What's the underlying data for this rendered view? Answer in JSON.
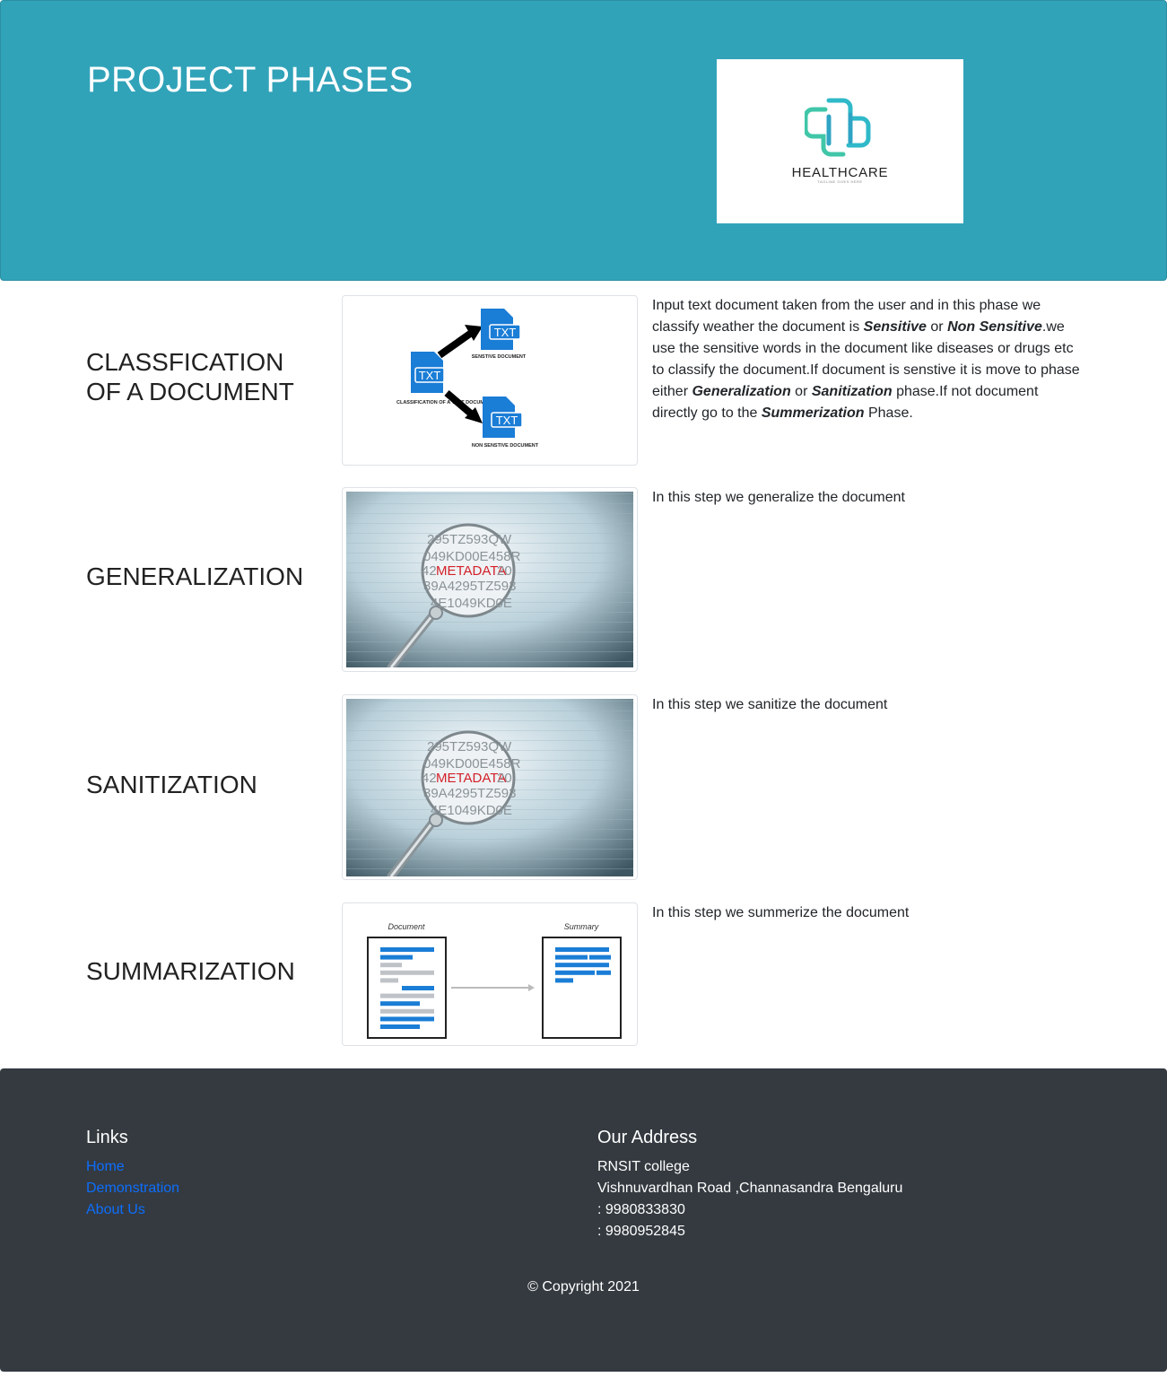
{
  "header": {
    "title": "PROJECT PHASES",
    "logo": {
      "name": "HEALTHCARE",
      "tagline": "TAGLINE GOES HERE"
    }
  },
  "phases": [
    {
      "title_line1": "CLASSFICATION",
      "title_line2": "OF A DOCUMENT",
      "diagram": {
        "source_label": "CLASSIFICATION OF A TEXT DOCUMENT",
        "file_label": "TXT",
        "sensitive_label": "SENSTIVE DOCUMENT",
        "nonsensitive_label": "NON SENSTIVE DOCUMENT"
      },
      "desc": {
        "p1": "Input text document taken from the user and in this phase we classify weather the document is ",
        "sensitive": "Sensitive",
        "or1": " or ",
        "non_sensitive": "Non Sensitive",
        "p2": ".we use the sensitive words in the document like diseases or drugs etc to classify the document.If document is senstive it is move to phase either ",
        "generalization": "Generalization",
        "or2": " or ",
        "sanitization": "Sanitization",
        "p3": " phase.If not document directly go to the ",
        "summerization": "Summerization",
        "p4": " Phase."
      }
    },
    {
      "title": "GENERALIZATION",
      "image": {
        "lines": [
          "295TZ593QW",
          "049KD00E458R",
          "42",
          "METADATA",
          "20",
          "39A4295TZ593",
          "4E1049KD0E"
        ]
      },
      "desc": "In this step we generalize the document"
    },
    {
      "title": "SANITIZATION",
      "image": {
        "lines": [
          "295TZ593QW",
          "049KD00E458R",
          "42",
          "METADATA",
          "20",
          "39A4295TZ593",
          "4E1049KD0E"
        ]
      },
      "desc": "In this step we sanitize the document"
    },
    {
      "title": "SUMMARIZATION",
      "diagram": {
        "left_label": "Document",
        "right_label": "Summary"
      },
      "desc": "In this step we summerize the document"
    }
  ],
  "footer": {
    "links_heading": "Links",
    "links": [
      "Home",
      "Demonstration",
      "About Us"
    ],
    "address_heading": "Our Address",
    "address": [
      "RNSIT college",
      "Vishnuvardhan Road ,Channasandra Bengaluru",
      ": 9980833830",
      ": 9980952845"
    ],
    "copyright": "© Copyright 2021"
  },
  "colors": {
    "header_bg": "#31a3b9",
    "footer_bg": "#343a40",
    "link": "#0d6efd",
    "logo_teal": "#3ec0c0",
    "doc_blue": "#1a7dd6",
    "metadata_red": "#d4202a"
  }
}
